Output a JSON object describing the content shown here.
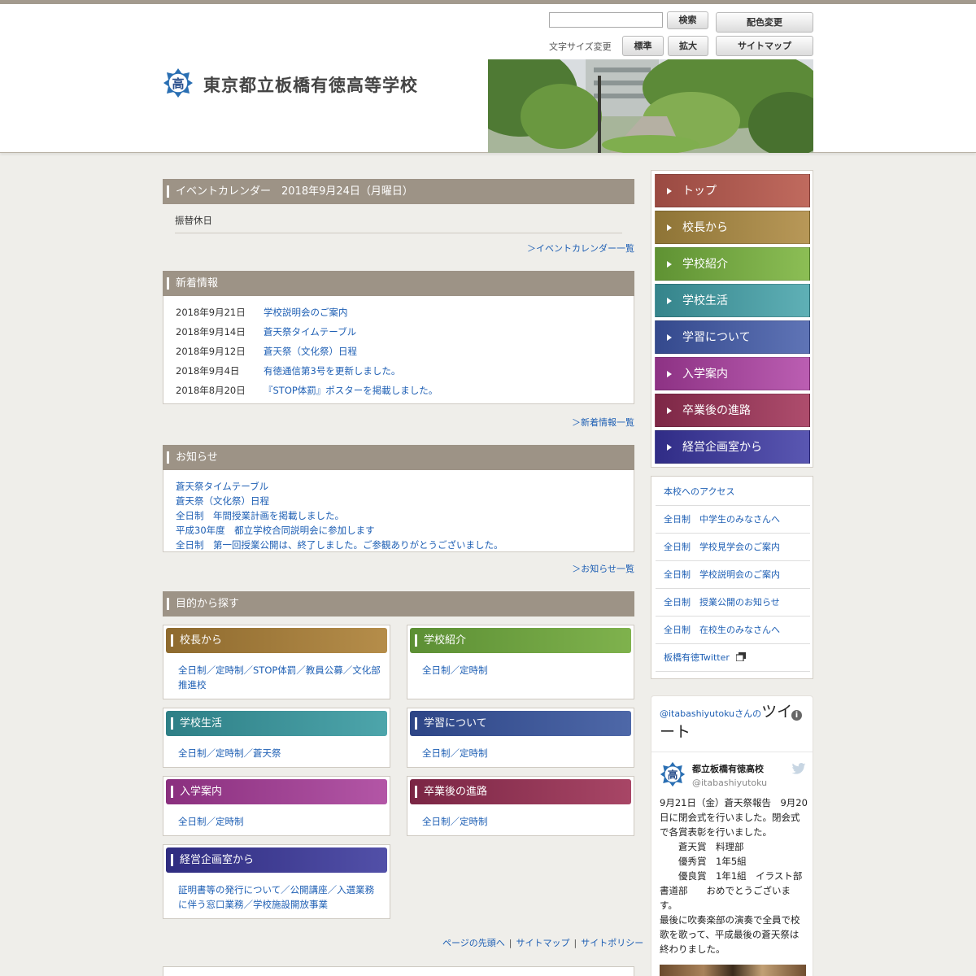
{
  "header": {
    "school_name": "東京都立板橋有徳高等学校",
    "search_button": "検索",
    "color_change": "配色変更",
    "font_size_label": "文字サイズ変更",
    "font_standard": "標準",
    "font_large": "拡大",
    "sitemap": "サイトマップ",
    "logo_char": "高"
  },
  "calendar": {
    "title": "イベントカレンダー　2018年9月24日（月曜日）",
    "entry": "振替休日",
    "more": "＞イベントカレンダー一覧"
  },
  "news": {
    "title": "新着情報",
    "items": [
      {
        "date": "2018年9月21日",
        "text": "学校説明会のご案内"
      },
      {
        "date": "2018年9月14日",
        "text": "蒼天祭タイムテーブル"
      },
      {
        "date": "2018年9月12日",
        "text": "蒼天祭（文化祭）日程"
      },
      {
        "date": "2018年9月4日",
        "text": "有徳通信第3号を更新しました。"
      },
      {
        "date": "2018年8月20日",
        "text": "『STOP体罰』ポスターを掲載しました。"
      }
    ],
    "more": "＞新着情報一覧"
  },
  "notices": {
    "title": "お知らせ",
    "items": [
      "蒼天祭タイムテーブル",
      "蒼天祭（文化祭）日程",
      "全日制　年間授業計画を掲載しました。",
      "平成30年度　都立学校合同説明会に参加します",
      "全日制　第一回授業公開は、終了しました。ご参観ありがとうございました。"
    ],
    "more": "＞お知らせ一覧"
  },
  "purpose": {
    "title": "目的から探す",
    "categories": [
      {
        "label": "校長から",
        "links": "全日制／定時制／STOP体罰／教員公募／文化部推進校"
      },
      {
        "label": "学校紹介",
        "links": "全日制／定時制"
      },
      {
        "label": "学校生活",
        "links": "全日制／定時制／蒼天祭"
      },
      {
        "label": "学習について",
        "links": "全日制／定時制"
      },
      {
        "label": "入学案内",
        "links": "全日制／定時制"
      },
      {
        "label": "卒業後の進路",
        "links": "全日制／定時制"
      },
      {
        "label": "経営企画室から",
        "links": "証明書等の発行について／公開講座／入選業務に伴う窓口業務／学校施設開放事業"
      }
    ]
  },
  "footer": {
    "page_top": "ページの先頭へ",
    "sitemap": "サイトマップ",
    "policy": "サイトポリシー",
    "sep": "|"
  },
  "nav": {
    "items": [
      "トップ",
      "校長から",
      "学校紹介",
      "学校生活",
      "学習について",
      "入学案内",
      "卒業後の進路",
      "経営企画室から"
    ],
    "colors": [
      "#9a4a42",
      "#8e7436",
      "#6a9a3c",
      "#3f8f96",
      "#3d5596",
      "#9b3d8e",
      "#8a3050",
      "#3a3590"
    ]
  },
  "quick_links": [
    "本校へのアクセス",
    "全日制　中学生のみなさんへ",
    "全日制　学校見学会のご案内",
    "全日制　学校説明会のご案内",
    "全日制　授業公開のお知らせ",
    "全日制　在校生のみなさんへ",
    "板橋有徳Twitter"
  ],
  "twitter": {
    "handle_link": "@itabashiyutoku",
    "suffix": "さんの",
    "heading": "ツイート",
    "display_name": "都立板橋有徳高校",
    "handle": "@itabashiyutoku",
    "text": "9月21日（金）蒼天祭報告　9月20日に閉会式を行いました。閉会式で各賞表彰を行いました。\n　　蒼天賞　料理部\n　　優秀賞　1年5組\n　　優良賞　1年1組　イラスト部　書道部　　おめでとうございます。\n最後に吹奏楽部の演奏で全員で校歌を歌って、平成最後の蒼天祭は終わりました。"
  }
}
